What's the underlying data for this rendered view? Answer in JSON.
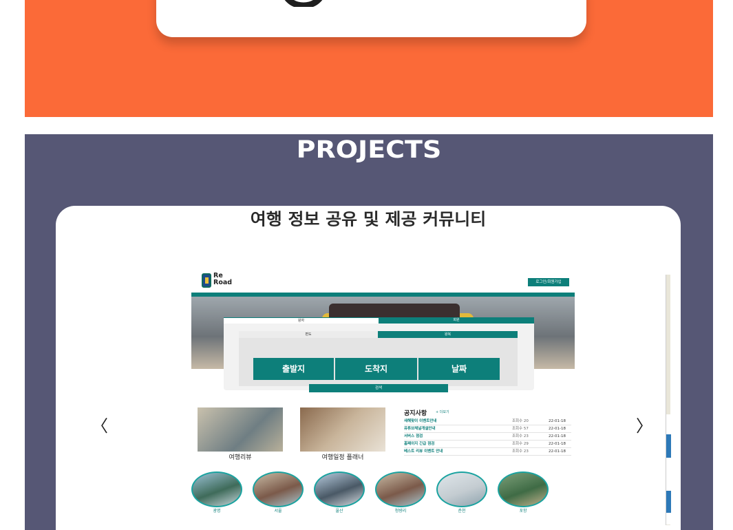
{
  "projects": {
    "heading": "PROJECTS",
    "card_title": "여행 정보 공유 및 제공 커뮤니티",
    "prev_label": "〈",
    "next_label": "〉"
  },
  "site": {
    "logo_line1": "Re",
    "logo_line2": "Road",
    "login_label": "로그인/회원가입",
    "search_tabs": [
      "왕자",
      "회원"
    ],
    "inner_tabs": [
      "편도",
      "왕복"
    ],
    "fields": [
      "출발지",
      "도착지",
      "날짜"
    ],
    "search_label": "검색",
    "thumbs": [
      "여행리뷰",
      "여행일정 플래너"
    ],
    "notice_title": "공지사항",
    "notice_more": "+ 더보기",
    "notices": [
      {
        "title": "새해맞이 이벤트안내",
        "views": "조회수 20",
        "date": "22-01-18"
      },
      {
        "title": "유튜브채널개설안내",
        "views": "조회수 57",
        "date": "22-01-18"
      },
      {
        "title": "서버스 점검",
        "views": "조회수 23",
        "date": "22-01-18"
      },
      {
        "title": "홈페이지 긴급 점검",
        "views": "조회수 29",
        "date": "22-01-18"
      },
      {
        "title": "베스트 리뷰 이벤트 안내",
        "views": "조회수 23",
        "date": "22-01-18"
      }
    ],
    "cities": [
      "광명",
      "서울",
      "울산",
      "청량리",
      "춘천",
      "포항"
    ]
  }
}
